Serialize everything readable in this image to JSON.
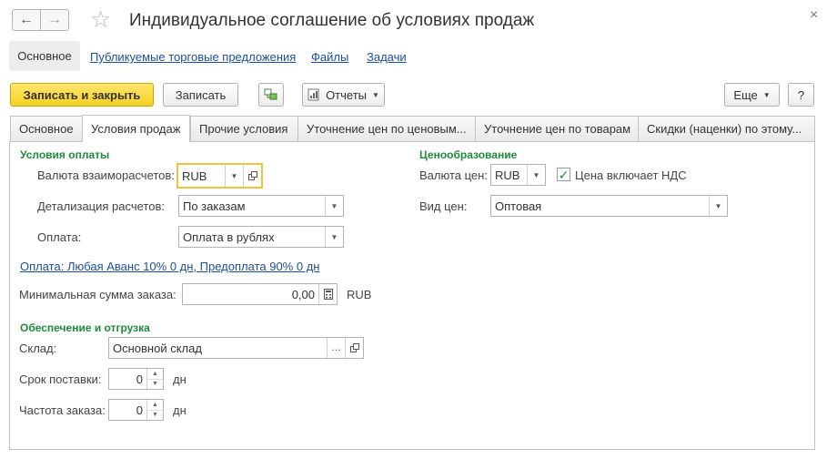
{
  "window": {
    "title": "Индивидуальное соглашение об условиях продаж",
    "back_icon": "←",
    "forward_icon": "→",
    "favorite_icon": "☆",
    "close_icon": "×"
  },
  "sections": {
    "active": "Основное",
    "links": [
      "Публикуемые торговые предложения",
      "Файлы",
      "Задачи"
    ]
  },
  "toolbar": {
    "save_close": "Записать и закрыть",
    "save": "Записать",
    "reports": "Отчеты",
    "more": "Еще",
    "help": "?"
  },
  "tabs": [
    "Основное",
    "Условия продаж",
    "Прочие условия",
    "Уточнение цен по ценовым...",
    "Уточнение цен по товарам",
    "Скидки (наценки) по этому..."
  ],
  "active_tab": "Условия продаж",
  "payment_terms": {
    "title": "Условия оплаты",
    "currency_label": "Валюта взаиморасчетов:",
    "currency_value": "RUB",
    "detail_label": "Детализация расчетов:",
    "detail_value": "По заказам",
    "payment_label": "Оплата:",
    "payment_value": "Оплата в рублях",
    "schedule_link": "Оплата: Любая Аванс 10% 0 дн, Предоплата 90% 0 дн",
    "min_sum_label": "Минимальная сумма заказа:",
    "min_sum_value": "0,00",
    "min_sum_currency": "RUB"
  },
  "pricing": {
    "title": "Ценообразование",
    "currency_label": "Валюта цен:",
    "currency_value": "RUB",
    "vat_label": "Цена включает НДС",
    "vat_checked": true,
    "price_type_label": "Вид цен:",
    "price_type_value": "Оптовая"
  },
  "shipping": {
    "title": "Обеспечение и отгрузка",
    "warehouse_label": "Склад:",
    "warehouse_value": "Основной склад",
    "delivery_label": "Срок поставки:",
    "delivery_value": "0",
    "delivery_unit": "дн",
    "frequency_label": "Частота заказа:",
    "frequency_value": "0",
    "frequency_unit": "дн"
  }
}
